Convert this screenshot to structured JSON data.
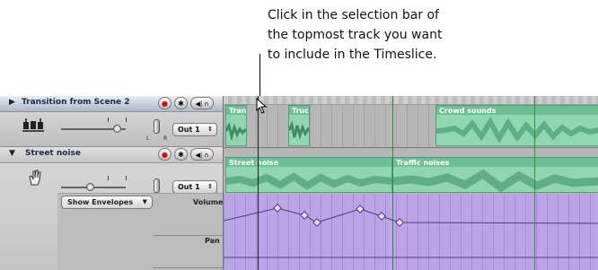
{
  "callout": {
    "lines": [
      "Click in the selection bar of",
      "the topmost track you want",
      "to include in the Timeslice."
    ]
  },
  "tracks": [
    {
      "name": "Transition from Scene 2",
      "output": "Out 1",
      "icon": "drum-kit-icon",
      "regions": [
        "Tran",
        "Truc",
        "Crowd sounds"
      ]
    },
    {
      "name": "Street noise",
      "output": "Out 1",
      "icon": "hand-icon",
      "envelope_select": "Show Envelopes",
      "parameters": [
        "Volume",
        "Pan"
      ],
      "regions": [
        "Street noise",
        "Traffic noises"
      ]
    }
  ],
  "controls": {
    "record": "●",
    "solo": "✱",
    "mute_headphones": "◀| ∩"
  },
  "slider_labels": {
    "left": "L",
    "right": "R"
  },
  "colors": {
    "audio_region": "#8fd6b1",
    "envelope_lane": "#bca5e6",
    "title_bar_selected": "#c5ccd9"
  }
}
